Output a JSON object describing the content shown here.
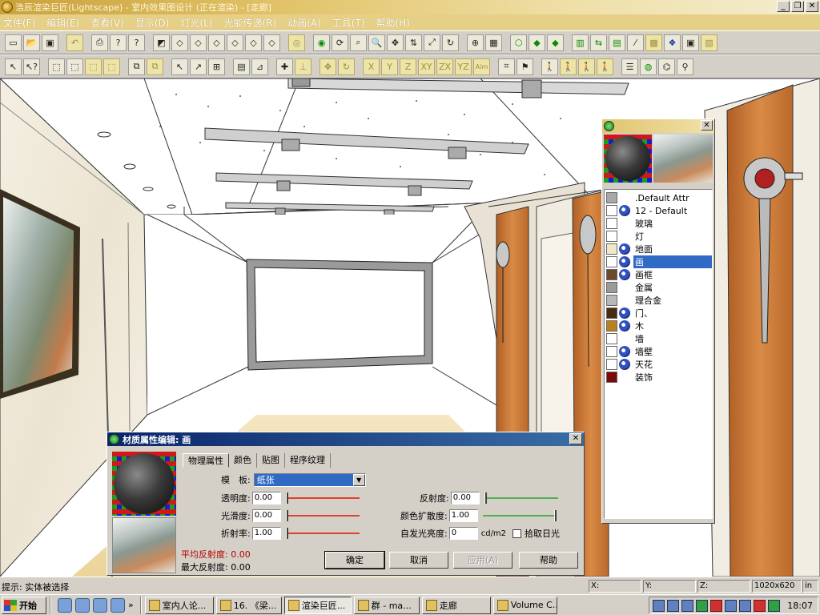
{
  "window": {
    "title": "浩辰渲染巨匠(Lightscape) - 室内效果图设计 (正在渲染) - [走廊]"
  },
  "menu": [
    "文件(F)",
    "编辑(E)",
    "查看(V)",
    "显示(D)",
    "灯光(L)",
    "光能传递(R)",
    "动画(A)",
    "工具(T)",
    "帮助(H)"
  ],
  "toolbar2_text": {
    "x": "X",
    "y": "Y",
    "z": "Z",
    "xy": "XY",
    "zx": "ZX",
    "yz": "YZ",
    "aim": "Aim"
  },
  "material_panel": {
    "items": [
      {
        "name": ".Default Attr",
        "color": "#a8a8a8",
        "texture": false
      },
      {
        "name": "12 - Default",
        "color": "#ffffff",
        "texture": true
      },
      {
        "name": "玻璃",
        "color": "#ffffff",
        "texture": false
      },
      {
        "name": "灯",
        "color": "#ffffff",
        "texture": false
      },
      {
        "name": "地面",
        "color": "#f2e8c8",
        "texture": true
      },
      {
        "name": "画",
        "color": "#ffffff",
        "texture": true,
        "selected": true
      },
      {
        "name": "画框",
        "color": "#6a4a2a",
        "texture": true
      },
      {
        "name": "金属",
        "color": "#9a9a9a",
        "texture": false
      },
      {
        "name": "理合金",
        "color": "#b8b8b8",
        "texture": false
      },
      {
        "name": "门、",
        "color": "#4a2a10",
        "texture": true
      },
      {
        "name": "木",
        "color": "#b8801e",
        "texture": true
      },
      {
        "name": "墙",
        "color": "#ffffff",
        "texture": false
      },
      {
        "name": "墙壁",
        "color": "#ffffff",
        "texture": true
      },
      {
        "name": "天花",
        "color": "#ffffff",
        "texture": true
      },
      {
        "name": "装饰",
        "color": "#7a0808",
        "texture": false
      }
    ]
  },
  "material_dialog": {
    "title": "材质属性编辑: 画",
    "tabs": [
      "物理属性",
      "颜色",
      "贴图",
      "程序纹理"
    ],
    "template_label": "模　板:",
    "template_value": "纸张",
    "transparency_label": "透明度:",
    "transparency_value": "0.00",
    "smoothness_label": "光滑度:",
    "smoothness_value": "0.00",
    "refraction_label": "折射率:",
    "refraction_value": "1.00",
    "reflectance_label": "反射度:",
    "reflectance_value": "0.00",
    "color_bleed_label": "颜色扩散度:",
    "color_bleed_value": "1.00",
    "luminance_label": "自发光亮度:",
    "luminance_value": "0",
    "luminance_unit": "cd/m2",
    "daylight_label": "拾取日光",
    "avg_reflectance": "平均反射度: 0.00",
    "max_reflectance": "最大反射度: 0.00",
    "ok": "确定",
    "cancel": "取消",
    "apply": "应用(A)",
    "help": "帮助"
  },
  "status": {
    "hint": "提示: 实体被选择",
    "x_label": "X:",
    "y_label": "Y:",
    "z_label": "Z:",
    "resolution": "1020x620",
    "unit": "in"
  },
  "taskbar": {
    "start": "开始",
    "tasks": [
      {
        "label": "室内人论...",
        "active": false
      },
      {
        "label": "16. 《梁...",
        "active": false
      },
      {
        "label": "渲染巨匠...",
        "active": true
      },
      {
        "label": "群 - ma...",
        "active": false
      },
      {
        "label": "走廊",
        "active": false
      },
      {
        "label": "Volume C...",
        "active": false
      }
    ],
    "clock": "18:07"
  },
  "colors": {
    "accent": "#316ac5",
    "title_gold": "#e2c36a",
    "wood": "#c9763a"
  }
}
